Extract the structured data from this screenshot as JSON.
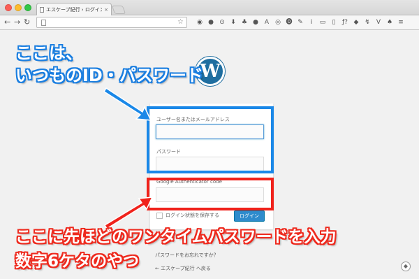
{
  "browser": {
    "tab_title": "エスケープ紀行 › ログイン",
    "tab_close": "×",
    "back": "←",
    "forward": "→",
    "reload": "↻",
    "star": "☆",
    "extensions": [
      "◉",
      "●",
      "⊙",
      "⬇",
      "♣",
      "●",
      "A",
      "◎",
      "⓿",
      "✎",
      "i",
      "▭",
      "▯",
      "ƒ?",
      "◆",
      "↯",
      "V",
      "♠",
      "≡"
    ]
  },
  "page": {
    "logo": "W",
    "username_label": "ユーザー名またはメールアドレス",
    "password_label": "パスワード",
    "ga_label": "Google Authenticator code",
    "remember_label": "ログイン状態を保存する",
    "login_button": "ログイン",
    "lost_password": "パスワードをお忘れですか？",
    "back_link": "← エスケープ紀行 へ戻る"
  },
  "annotations": {
    "blue_line1": "ここは、",
    "blue_line2": "いつものID・パスワード",
    "red_line1": "ここに先ほどのワンタイムパスワードを入力",
    "red_line2": "数字6ケタのやつ",
    "blue_color": "#1a88e8",
    "red_color": "#f0221b"
  }
}
